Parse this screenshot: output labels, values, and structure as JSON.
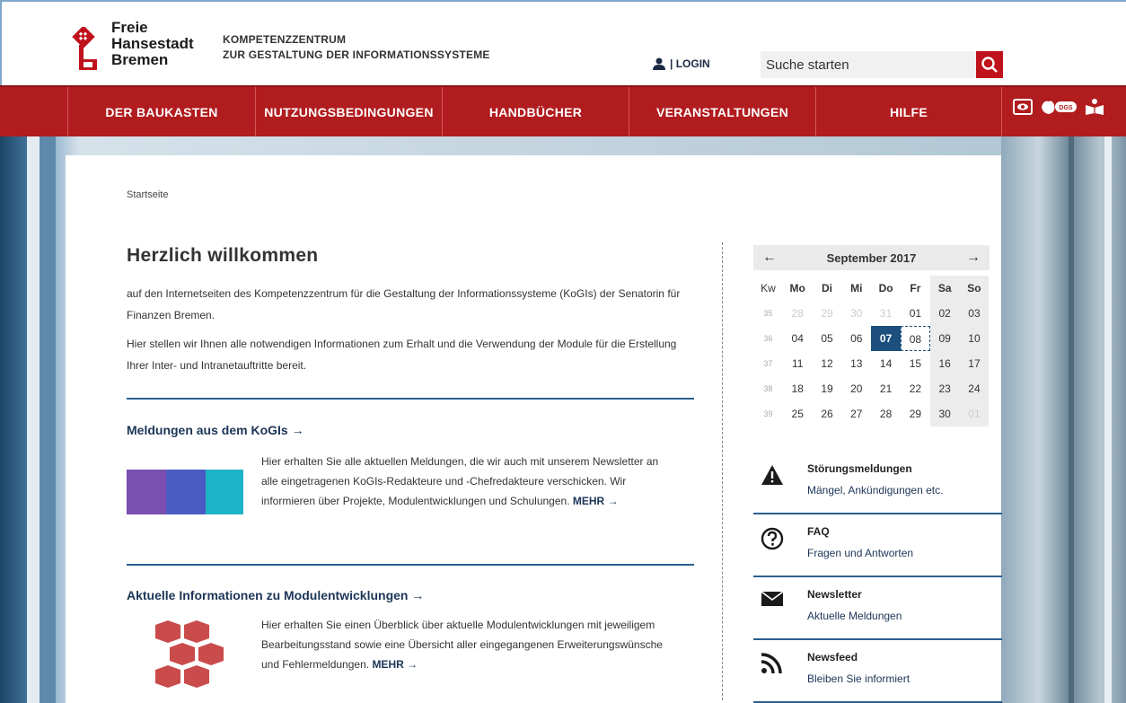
{
  "header": {
    "logo_lines": [
      "Freie",
      "Hansestadt",
      "Bremen"
    ],
    "subtitle_lines": [
      "KOMPETENZZENTRUM",
      "ZUR GESTALTUNG DER INFORMATIONSSYSTEME"
    ],
    "login_label": "| LOGIN",
    "search_placeholder": "Suche starten"
  },
  "nav": {
    "items": [
      {
        "label": "DER BAUKASTEN"
      },
      {
        "label": "NUTZUNGSBEDINGUNGEN"
      },
      {
        "label": "HANDBÜCHER"
      },
      {
        "label": "VERANSTALTUNGEN"
      },
      {
        "label": "HILFE"
      }
    ],
    "tools": [
      {
        "icon": "eye-icon"
      },
      {
        "icon": "sign-language-icon",
        "label": "DGS"
      },
      {
        "icon": "easy-language-icon"
      }
    ]
  },
  "main": {
    "breadcrumb": "Startseite",
    "title": "Herzlich willkommen",
    "intro_1": "auf den Internetseiten des Kompetenzzentrum für die Gestaltung der Informationssysteme (KoGIs) der Senatorin für Finanzen Bremen.",
    "intro_2": "Hier stellen wir Ihnen alle notwendigen Informationen zum Erhalt und die Verwendung der Module für die Erstellung Ihrer Inter- und Intranetauftritte bereit.",
    "sections": [
      {
        "title": "Meldungen aus dem KoGIs",
        "text": "Hier erhalten Sie alle aktuellen Meldungen, die wir auch mit unserem Newsletter an alle eingetragenen KoGIs-Redakteure und -Chefredakteure verschicken. Wir informieren über Projekte, Modulentwicklungen und Schulungen.",
        "more": "MEHR"
      },
      {
        "title": "Aktuelle Informationen zu Modulentwicklungen",
        "text": "Hier erhalten Sie einen Überblick über aktuelle Modulentwicklungen mit jeweiligem Bearbeitungsstand sowie eine Übersicht aller eingegangenen Erweiterungswünsche und Fehlermeldungen.",
        "more": "MEHR"
      }
    ]
  },
  "calendar": {
    "month": "September 2017",
    "headers": [
      "Kw",
      "Mo",
      "Di",
      "Mi",
      "Do",
      "Fr",
      "Sa",
      "So"
    ],
    "weeks": [
      {
        "kw": "35",
        "days": [
          "28",
          "29",
          "30",
          "31",
          "01",
          "02",
          "03"
        ]
      },
      {
        "kw": "36",
        "days": [
          "04",
          "05",
          "06",
          "07",
          "08",
          "09",
          "10"
        ]
      },
      {
        "kw": "37",
        "days": [
          "11",
          "12",
          "13",
          "14",
          "15",
          "16",
          "17"
        ]
      },
      {
        "kw": "38",
        "days": [
          "18",
          "19",
          "20",
          "21",
          "22",
          "23",
          "24"
        ]
      },
      {
        "kw": "39",
        "days": [
          "25",
          "26",
          "27",
          "28",
          "29",
          "30",
          "01"
        ]
      }
    ],
    "today": "07",
    "selected": "08"
  },
  "side_links": [
    {
      "icon": "warning-icon",
      "title": "Störungsmeldungen",
      "sub": "Mängel, Ankündigungen etc."
    },
    {
      "icon": "question-icon",
      "title": "FAQ",
      "sub": "Fragen und Antworten"
    },
    {
      "icon": "envelope-icon",
      "title": "Newsletter",
      "sub": "Aktuelle Meldungen"
    },
    {
      "icon": "rss-icon",
      "title": "Newsfeed",
      "sub": "Bleiben Sie informiert"
    }
  ],
  "colors": {
    "brand_red": "#b11c1f",
    "navy": "#1c3557",
    "accent_blue": "#1c4f7d"
  }
}
